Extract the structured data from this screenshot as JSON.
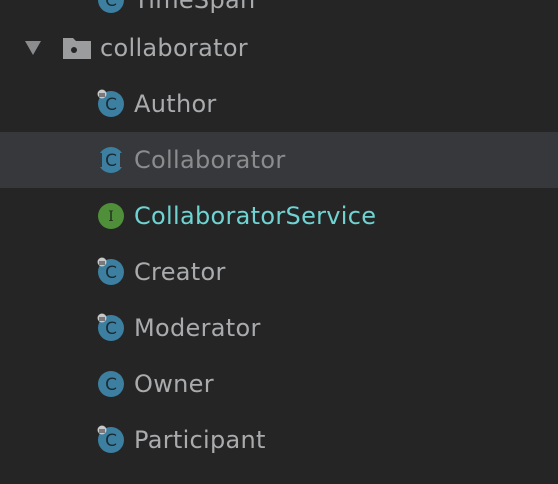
{
  "tree": {
    "partial_top": {
      "label": "TimeSpan",
      "kind": "class"
    },
    "package": {
      "label": "collaborator",
      "expanded": true
    },
    "items": [
      {
        "label": "Author",
        "kind": "class",
        "lock": true
      },
      {
        "label": "Collaborator",
        "kind": "abstract-class",
        "lock": false,
        "selected": true
      },
      {
        "label": "CollaboratorService",
        "kind": "interface",
        "lock": false,
        "modified": true
      },
      {
        "label": "Creator",
        "kind": "class",
        "lock": true
      },
      {
        "label": "Moderator",
        "kind": "class",
        "lock": true
      },
      {
        "label": "Owner",
        "kind": "class",
        "lock": false
      },
      {
        "label": "Participant",
        "kind": "class",
        "lock": true
      }
    ]
  },
  "colors": {
    "background": "#252526",
    "selected_row": "#36383b",
    "text": "#a9abad",
    "modified_text": "#6fd3d2",
    "class_icon": "#3c7fa0",
    "interface_icon": "#4f8f3a"
  }
}
